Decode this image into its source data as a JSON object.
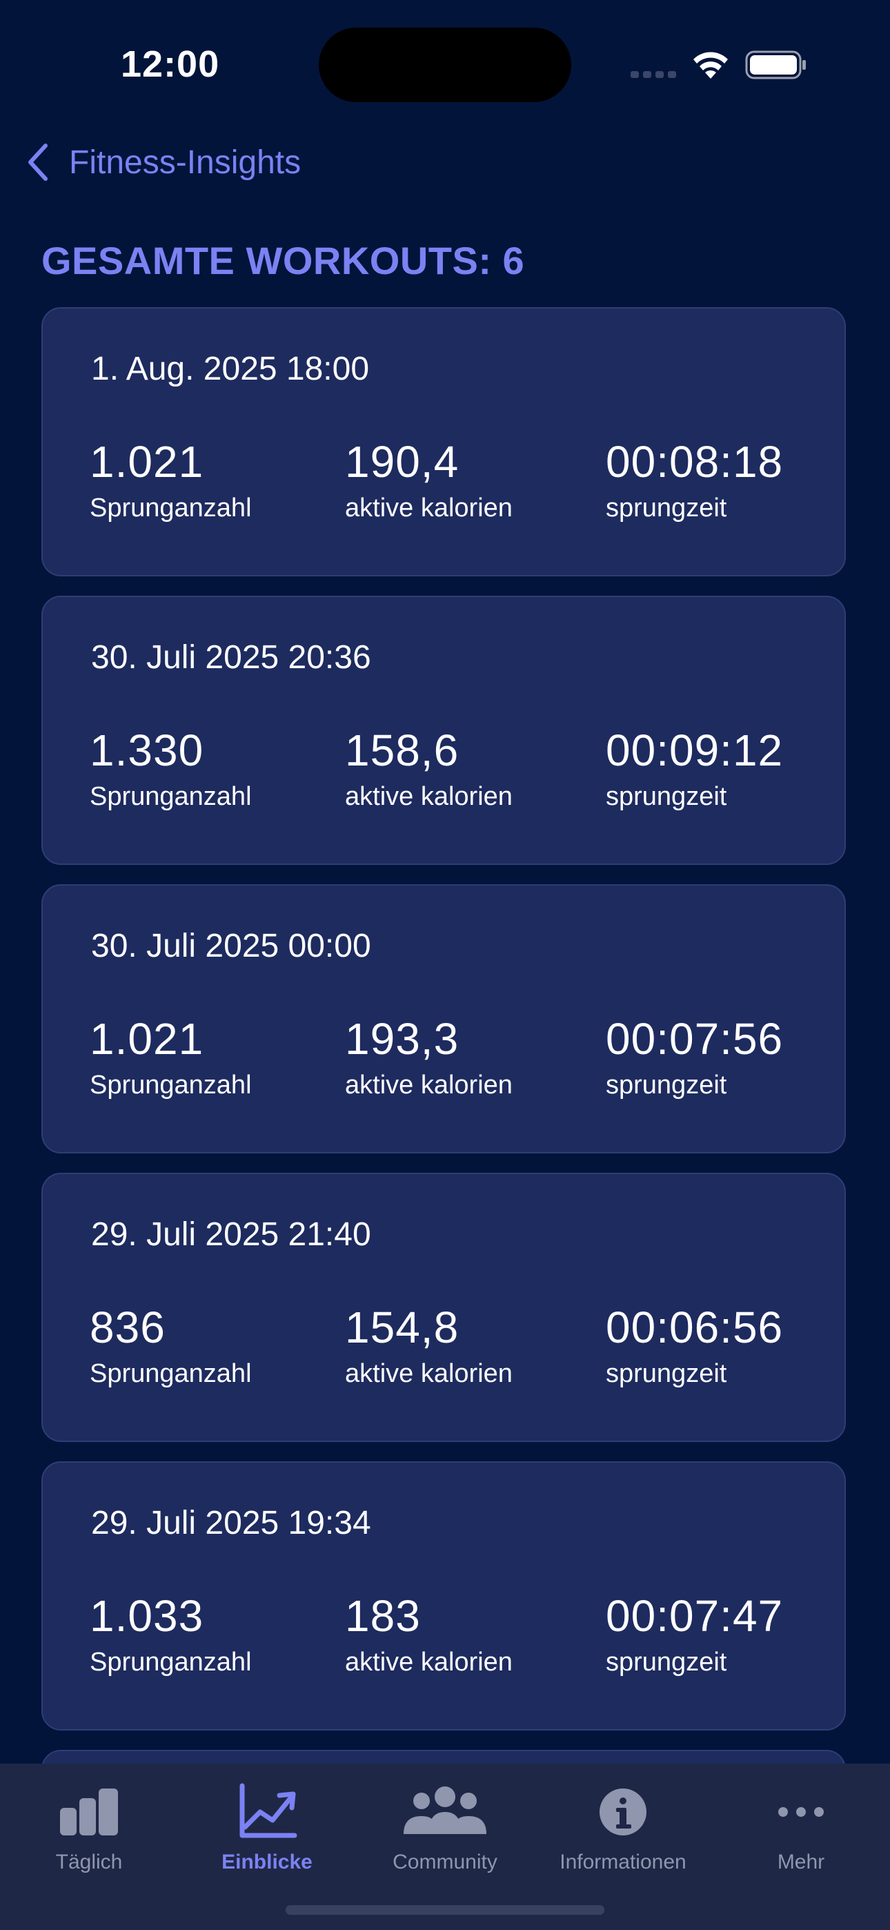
{
  "status_bar": {
    "time": "12:00"
  },
  "nav": {
    "back_label": "Fitness-Insights"
  },
  "title": "GESAMTE WORKOUTS: 6",
  "labels": {
    "jumps": "Sprunganzahl",
    "calories": "aktive kalorien",
    "time": "sprungzeit"
  },
  "workouts": [
    {
      "date": "1. Aug. 2025 18:00",
      "jumps": "1.021",
      "calories": "190,4",
      "time": "00:08:18"
    },
    {
      "date": "30. Juli 2025 20:36",
      "jumps": "1.330",
      "calories": "158,6",
      "time": "00:09:12"
    },
    {
      "date": "30. Juli 2025 00:00",
      "jumps": "1.021",
      "calories": "193,3",
      "time": "00:07:56"
    },
    {
      "date": "29. Juli 2025 21:40",
      "jumps": "836",
      "calories": "154,8",
      "time": "00:06:56"
    },
    {
      "date": "29. Juli 2025 19:34",
      "jumps": "1.033",
      "calories": "183",
      "time": "00:07:47"
    }
  ],
  "tabs": [
    {
      "label": "Täglich",
      "icon": "bar-chart-icon",
      "active": false
    },
    {
      "label": "Einblicke",
      "icon": "trend-chart-icon",
      "active": true
    },
    {
      "label": "Community",
      "icon": "people-icon",
      "active": false
    },
    {
      "label": "Informationen",
      "icon": "info-icon",
      "active": false
    },
    {
      "label": "Mehr",
      "icon": "more-icon",
      "active": false
    }
  ],
  "colors": {
    "background": "#03143a",
    "card": "#1e2b5f",
    "accent": "#7b82f3",
    "tab_inactive": "#8f96ae"
  }
}
